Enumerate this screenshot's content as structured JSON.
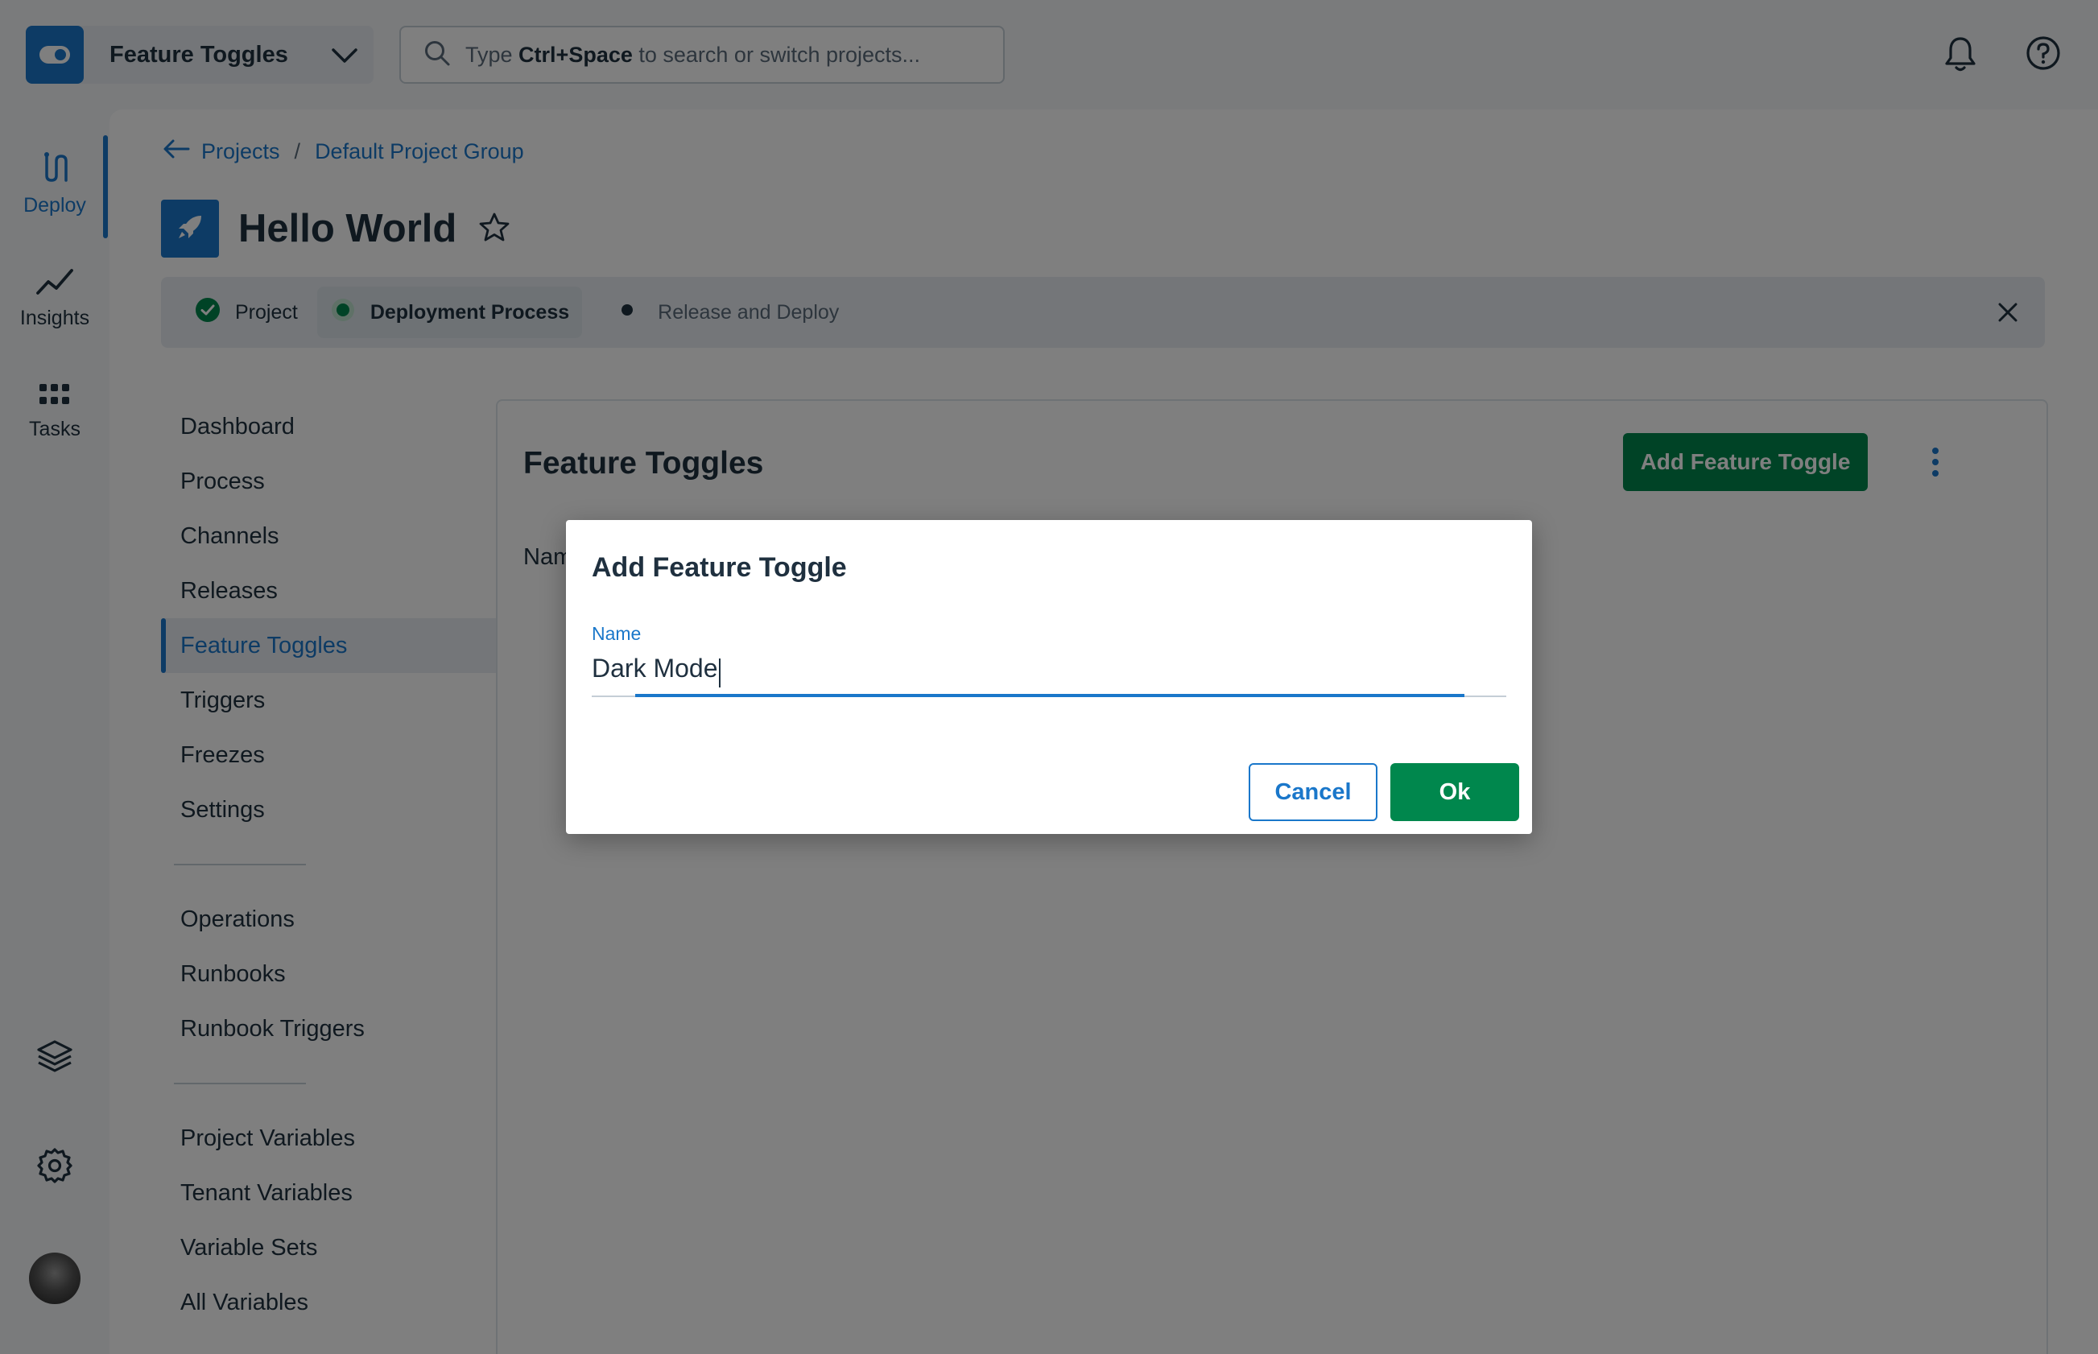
{
  "topbar": {
    "space_name": "Feature Toggles",
    "search_prefix": "Type ",
    "search_shortcut": "Ctrl+Space",
    "search_suffix": " to search or switch projects..."
  },
  "rail": {
    "items": [
      {
        "label": "Deploy",
        "icon": "deploy-icon"
      },
      {
        "label": "Insights",
        "icon": "insights-icon"
      },
      {
        "label": "Tasks",
        "icon": "tasks-icon"
      }
    ]
  },
  "breadcrumb": {
    "projects": "Projects",
    "separator": "/",
    "group": "Default Project Group"
  },
  "project": {
    "title": "Hello World"
  },
  "onboarding": {
    "steps": [
      {
        "label": "Project",
        "status": "complete"
      },
      {
        "label": "Deployment Process",
        "status": "current"
      },
      {
        "label": "Release and Deploy",
        "status": "pending"
      }
    ]
  },
  "subnav": {
    "group1": [
      "Dashboard",
      "Process",
      "Channels",
      "Releases",
      "Feature Toggles",
      "Triggers",
      "Freezes",
      "Settings"
    ],
    "group2": [
      "Operations",
      "Runbooks",
      "Runbook Triggers"
    ],
    "group3": [
      "Project Variables",
      "Tenant Variables",
      "Variable Sets",
      "All Variables"
    ],
    "active": "Feature Toggles"
  },
  "content": {
    "title": "Feature Toggles",
    "add_button": "Add Feature Toggle",
    "name_column": "Nam"
  },
  "dialog": {
    "title": "Add Feature Toggle",
    "field_label": "Name",
    "field_value": "Dark Mode",
    "cancel": "Cancel",
    "ok": "Ok"
  },
  "colors": {
    "accent": "#1a77ca",
    "primary_green": "#00874d",
    "text": "#1f303f",
    "overlay": "rgba(0,0,0,0.5)"
  }
}
